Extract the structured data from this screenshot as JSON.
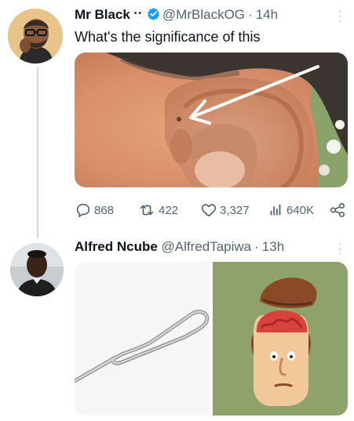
{
  "tweet1": {
    "display_name": "Mr Black",
    "name_decoration": "⠐⠂",
    "handle": "@MrBlackOG",
    "separator": "·",
    "time": "14h",
    "text": "What's the significance of this",
    "avatar_icon": "profile-photo",
    "media_icon": "ear-photo-with-arrow",
    "stats": {
      "replies": "868",
      "retweets": "422",
      "likes": "3,327",
      "views": "640K"
    }
  },
  "tweet2": {
    "display_name": "Alfred Ncube",
    "handle": "@AlfredTapiwa",
    "separator": "·",
    "time": "13h",
    "avatar_icon": "profile-photo",
    "media": [
      "sim-ejector-pin-image",
      "open-head-brain-cartoon"
    ]
  },
  "colors": {
    "verified": "#1d9bf0",
    "secondary_text": "#536471",
    "thread_line": "#cfd9de"
  }
}
